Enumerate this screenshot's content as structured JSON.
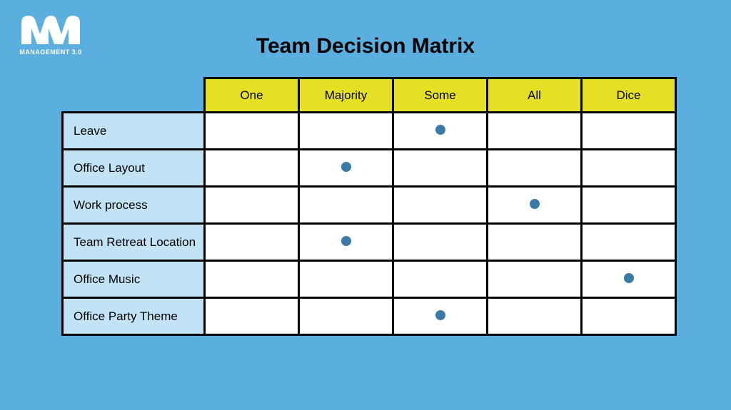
{
  "logo": {
    "label": "MANAGEMENT 3.0"
  },
  "title": "Team Decision Matrix",
  "columns": [
    "One",
    "Majority",
    "Some",
    "All",
    "Dice"
  ],
  "rows": [
    {
      "label": "Leave",
      "marks": [
        false,
        false,
        true,
        false,
        false
      ]
    },
    {
      "label": "Office Layout",
      "marks": [
        false,
        true,
        false,
        false,
        false
      ]
    },
    {
      "label": "Work process",
      "marks": [
        false,
        false,
        false,
        true,
        false
      ]
    },
    {
      "label": "Team Retreat Location",
      "marks": [
        false,
        true,
        false,
        false,
        false
      ]
    },
    {
      "label": "Office Music",
      "marks": [
        false,
        false,
        false,
        false,
        true
      ]
    },
    {
      "label": "Office Party Theme",
      "marks": [
        false,
        false,
        true,
        false,
        false
      ]
    }
  ],
  "chart_data": {
    "type": "table",
    "title": "Team Decision Matrix",
    "columns": [
      "One",
      "Majority",
      "Some",
      "All",
      "Dice"
    ],
    "rows": [
      "Leave",
      "Office Layout",
      "Work process",
      "Team Retreat Location",
      "Office Music",
      "Office Party Theme"
    ],
    "selections": {
      "Leave": "Some",
      "Office Layout": "Majority",
      "Work process": "All",
      "Team Retreat Location": "Majority",
      "Office Music": "Dice",
      "Office Party Theme": "Some"
    }
  }
}
